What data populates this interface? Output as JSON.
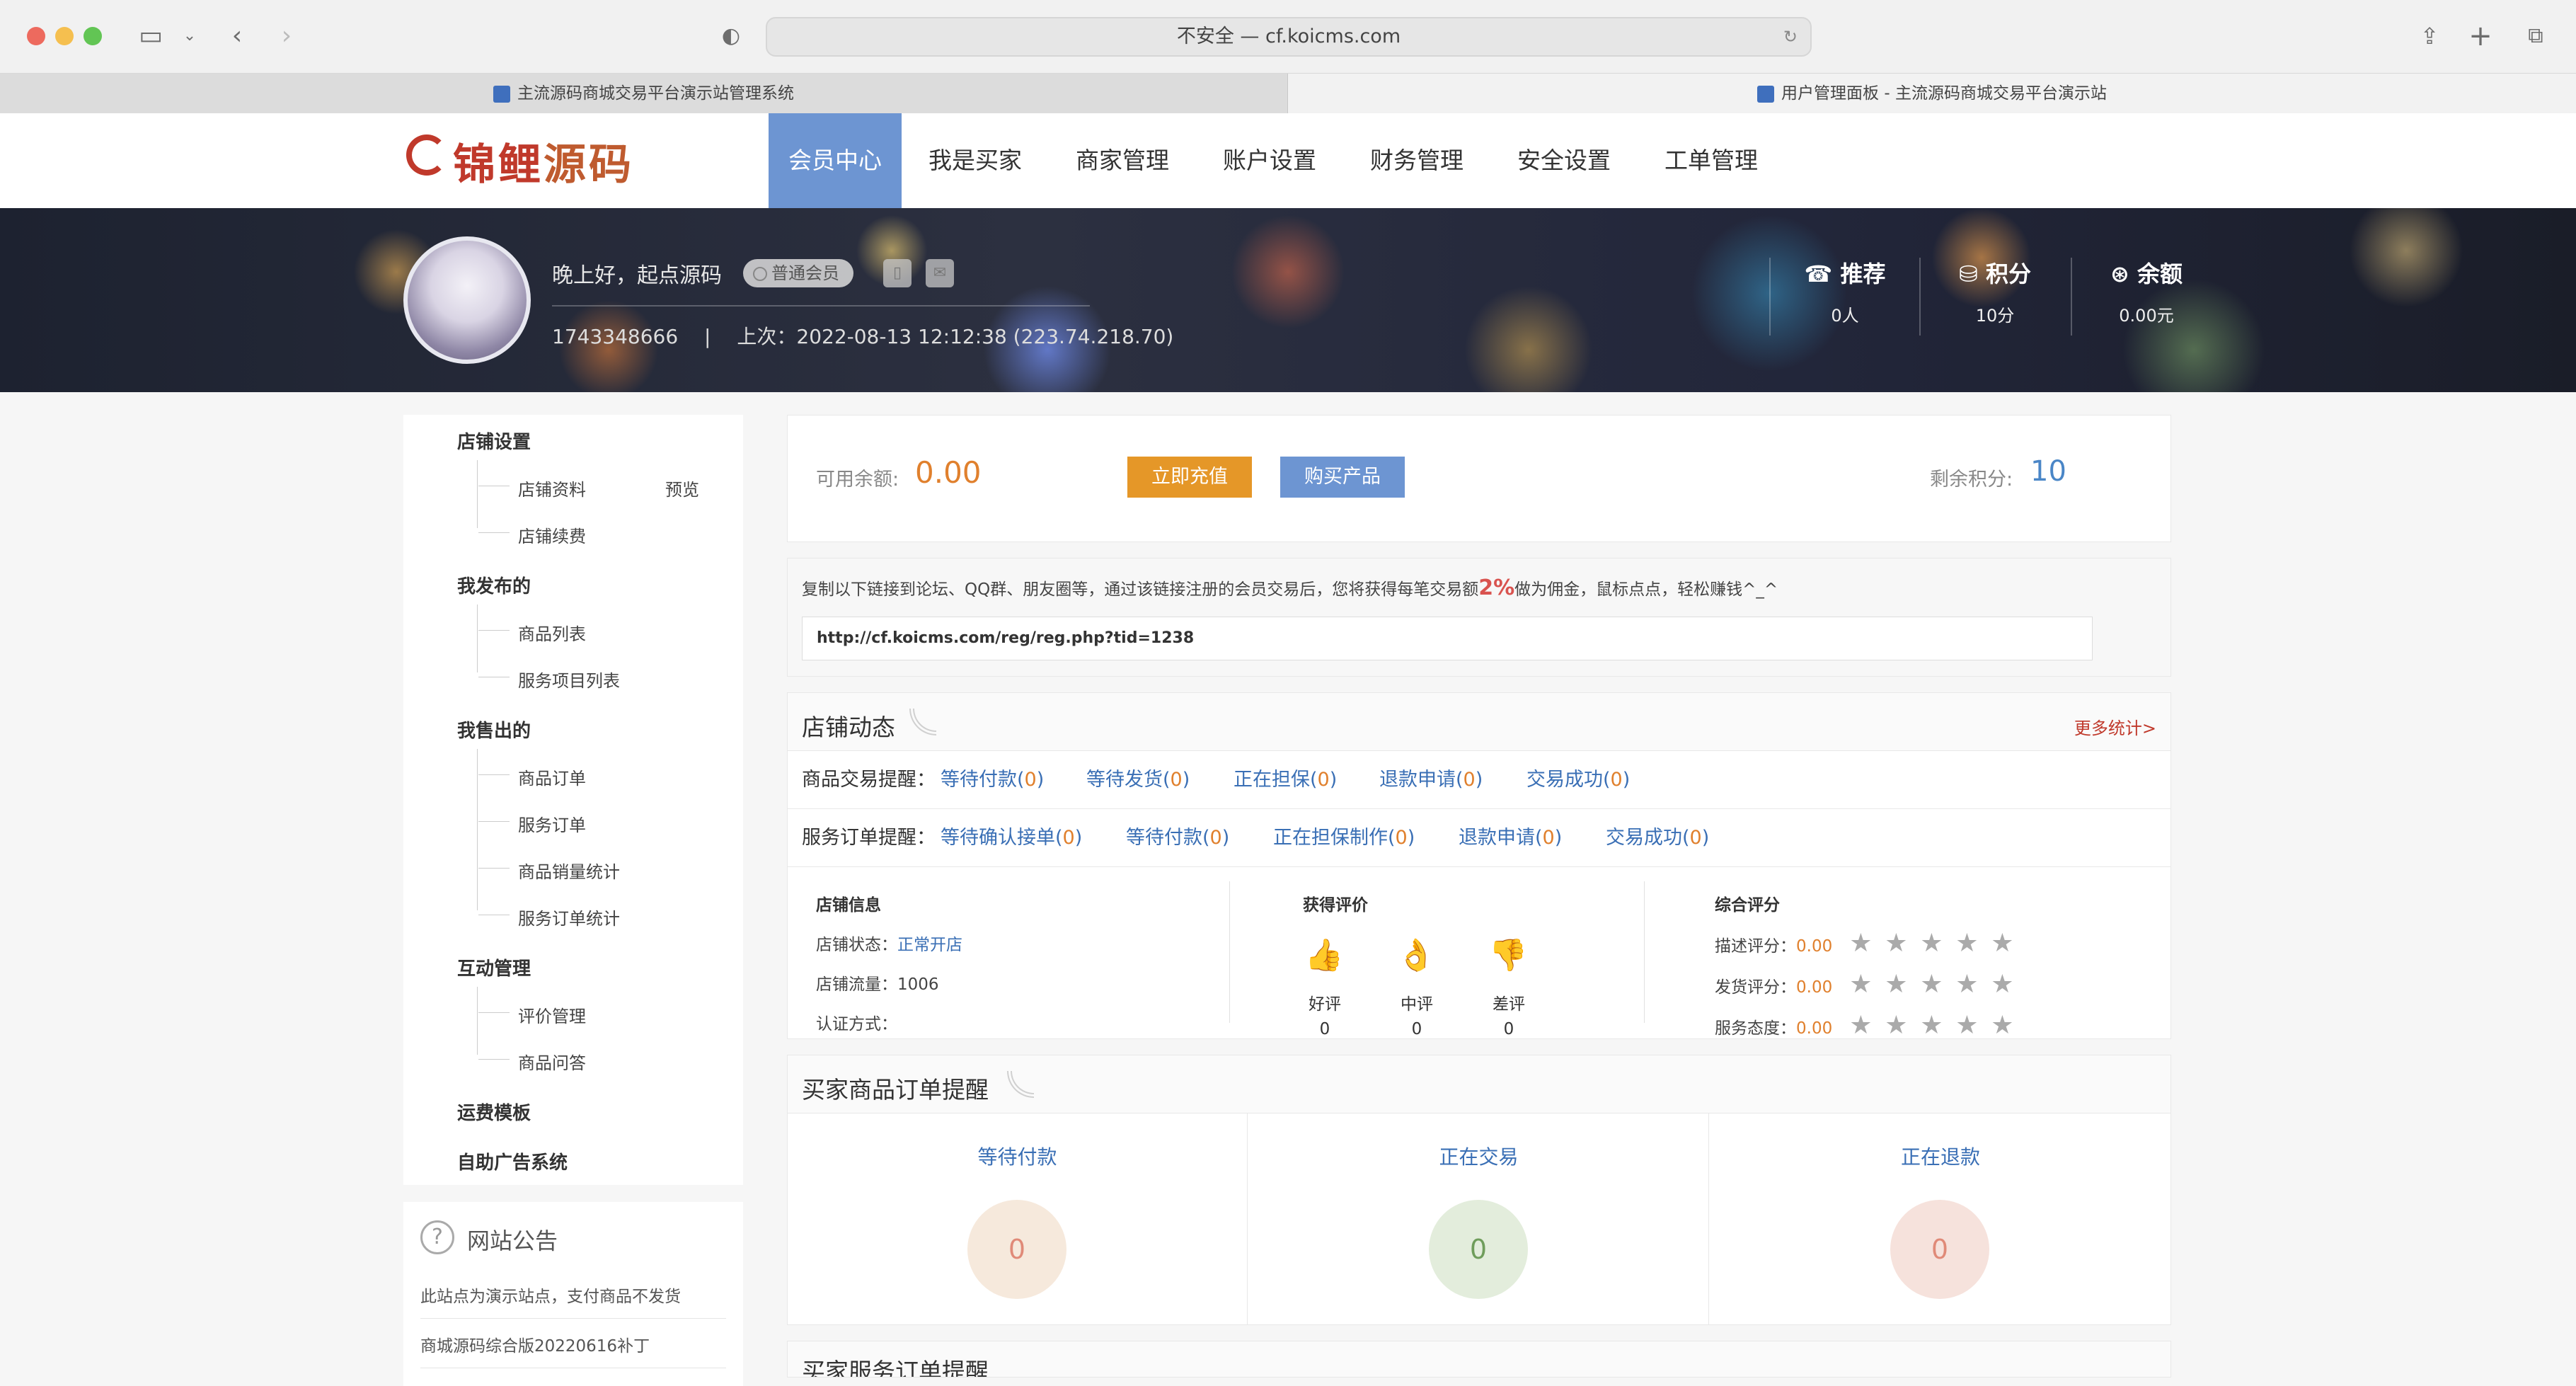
{
  "browser": {
    "url": "不安全 — cf.koicms.com",
    "tabs": [
      {
        "title": "主流源码商城交易平台演示站管理系统"
      },
      {
        "title": "用户管理面板 - 主流源码商城交易平台演示站"
      }
    ]
  },
  "logo": {
    "part1": "锦鲤",
    "part2": "源码"
  },
  "nav": {
    "items": [
      "会员中心",
      "我是买家",
      "商家管理",
      "账户设置",
      "财务管理",
      "安全设置",
      "工单管理"
    ]
  },
  "user": {
    "greeting": "晚上好，起点源码",
    "badge": "普通会员",
    "meta": "1743348666 　|　 上次：2022-08-13 12:12:38 (223.74.218.70)"
  },
  "stats": [
    {
      "label": "推荐",
      "icon": "phone-icon",
      "value": "0人"
    },
    {
      "label": "积分",
      "icon": "coins-icon",
      "value": "10分"
    },
    {
      "label": "余额",
      "icon": "yen-icon",
      "value": "0.00元"
    }
  ],
  "sidebar": {
    "groups": [
      {
        "title": "店铺设置",
        "items": [
          "店铺资料",
          "店铺续费"
        ]
      },
      {
        "title": "我发布的",
        "items": [
          "商品列表",
          "服务项目列表"
        ]
      },
      {
        "title": "我售出的",
        "items": [
          "商品订单",
          "服务订单",
          "商品销量统计",
          "服务订单统计"
        ]
      },
      {
        "title": "互动管理",
        "items": [
          "评价管理",
          "商品问答"
        ]
      },
      {
        "title": "运费模板",
        "items": []
      },
      {
        "title": "自助广告系统",
        "items": []
      }
    ],
    "preview": "预览"
  },
  "notice": {
    "title": "网站公告",
    "items": [
      "此站点为演示站点，支付商品不发货",
      "商城源码综合版20220616补丁"
    ]
  },
  "balance": {
    "label": "可用余额:",
    "value": "0.00",
    "recharge": "立即充值",
    "buy": "购买产品",
    "points_label": "剩余积分:",
    "points_value": "10"
  },
  "invite": {
    "text_before": "复制以下链接到论坛、QQ群、朋友圈等，通过该链接注册的会员交易后，您将获得每笔交易额",
    "percent": "2%",
    "text_after": "做为佣金，鼠标点点，轻松赚钱^_^",
    "link": "http://cf.koicms.com/reg/reg.php?tid=1238"
  },
  "shop": {
    "title": "店铺动态",
    "more": "更多统计>",
    "goods_reminder": {
      "label": "商品交易提醒：",
      "items": [
        {
          "text": "等待付款",
          "count": "0"
        },
        {
          "text": "等待发货",
          "count": "0"
        },
        {
          "text": "正在担保",
          "count": "0"
        },
        {
          "text": "退款申请",
          "count": "0"
        },
        {
          "text": "交易成功",
          "count": "0"
        }
      ]
    },
    "service_reminder": {
      "label": "服务订单提醒：",
      "items": [
        {
          "text": "等待确认接单",
          "count": "0"
        },
        {
          "text": "等待付款",
          "count": "0"
        },
        {
          "text": "正在担保制作",
          "count": "0"
        },
        {
          "text": "退款申请",
          "count": "0"
        },
        {
          "text": "交易成功",
          "count": "0"
        }
      ]
    },
    "info": {
      "title": "店铺信息",
      "status_label": "店铺状态：",
      "status": "正常开店",
      "traffic_label": "店铺流量：",
      "traffic": "1006",
      "cert_label": "认证方式："
    },
    "eval": {
      "title": "获得评价",
      "items": [
        {
          "label": "好评",
          "count": "0",
          "icon": "thumbs-up-icon"
        },
        {
          "label": "中评",
          "count": "0",
          "icon": "ok-hand-icon"
        },
        {
          "label": "差评",
          "count": "0",
          "icon": "thumbs-down-icon"
        }
      ]
    },
    "rating": {
      "title": "综合评分",
      "items": [
        {
          "label": "描述评分：",
          "value": "0.00",
          "stars": 0
        },
        {
          "label": "发货评分：",
          "value": "0.00",
          "stars": 0
        },
        {
          "label": "服务态度：",
          "value": "0.00",
          "stars": 0
        }
      ]
    }
  },
  "buyer_orders": {
    "title": "买家商品订单提醒",
    "boxes": [
      {
        "title": "等待付款",
        "count": "0",
        "color": "#f6e9dc",
        "text": "#e08a78"
      },
      {
        "title": "正在交易",
        "count": "0",
        "color": "#e3eddc",
        "text": "#6f9d5b"
      },
      {
        "title": "正在退款",
        "count": "0",
        "color": "#f6e2dc",
        "text": "#e08a78"
      }
    ]
  },
  "buyer_service": {
    "title": "买家服务订单提醒"
  }
}
